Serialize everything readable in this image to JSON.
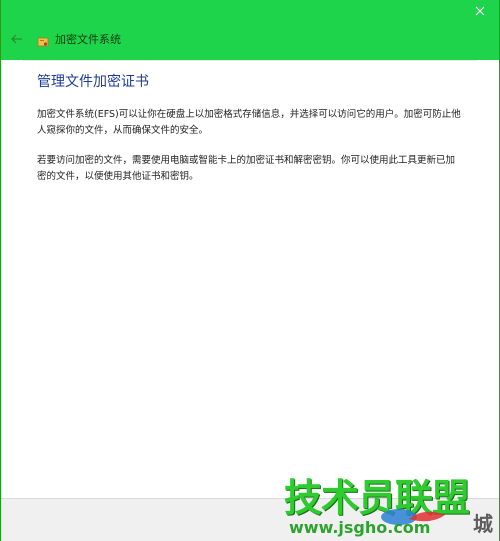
{
  "window": {
    "title": "加密文件系统",
    "close_glyph": "✕",
    "back_glyph": "←"
  },
  "content": {
    "heading": "管理文件加密证书",
    "paragraphs": [
      "加密文件系统(EFS)可以让你在硬盘上以加密格式存储信息，并选择可以访问它的用户。加密可防止他人窥探你的文件，从而确保文件的安全。",
      "若要访问加密的文件，需要使用电脑或智能卡上的加密证书和解密密钥。你可以使用此工具更新已加密的文件，以便使用其他证书和密钥。"
    ]
  },
  "watermark": {
    "main": "技术员联盟",
    "url": "www.jsgho.com",
    "side": "城"
  },
  "colors": {
    "titlebar": "#1ed44a",
    "heading": "#1e3c9a",
    "watermark": "#1ec81e"
  }
}
